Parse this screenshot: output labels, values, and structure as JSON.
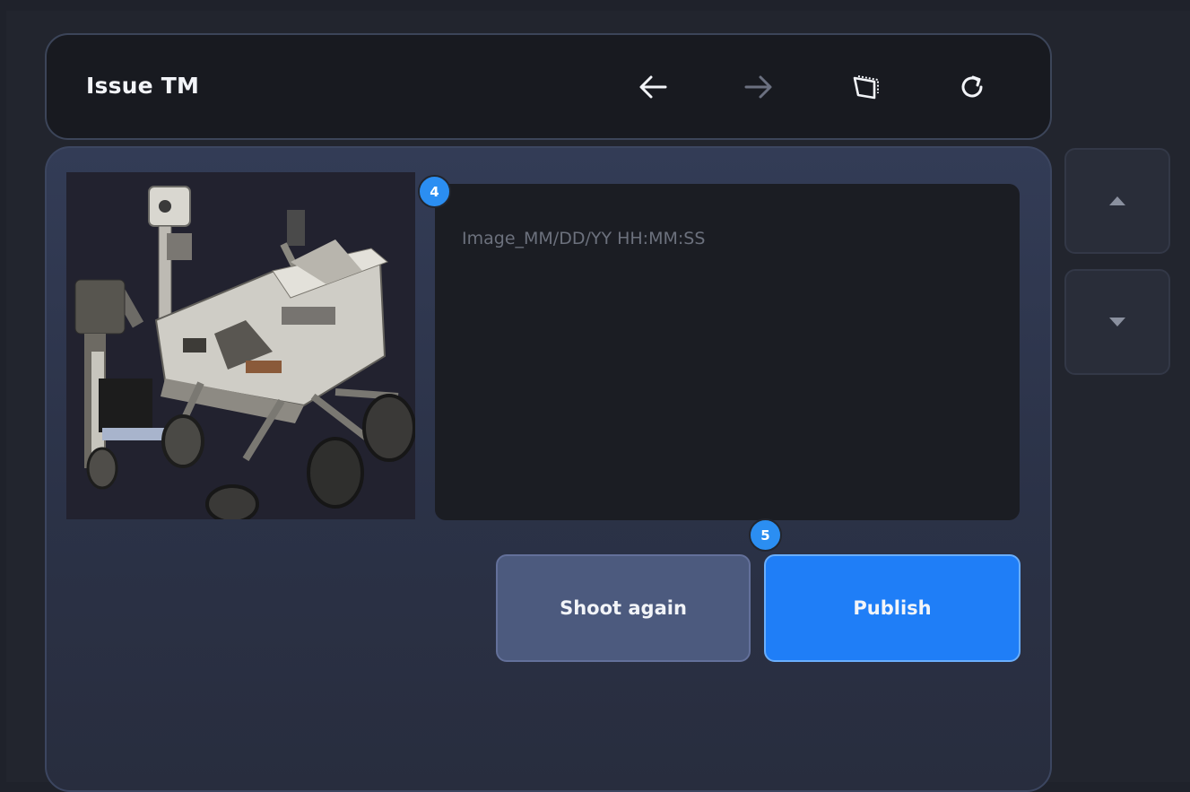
{
  "header": {
    "title": "Issue TM",
    "icons": {
      "back": "arrow-left-icon",
      "forward": "arrow-right-icon",
      "screen": "screen-capture-icon",
      "reload": "reload-icon"
    }
  },
  "preview": {
    "image": "rover-photo"
  },
  "caption": {
    "placeholder": "Image_MM/DD/YY HH:MM:SS"
  },
  "actions": {
    "shoot_again": "Shoot again",
    "publish": "Publish"
  },
  "badges": {
    "caption_step": "4",
    "publish_step": "5"
  },
  "side_nav": {
    "up": "caret-up-icon",
    "down": "caret-down-icon"
  },
  "colors": {
    "accent": "#1f7ef7",
    "badge": "#2b8ef2",
    "secondary_button": "#4c5a7e"
  }
}
